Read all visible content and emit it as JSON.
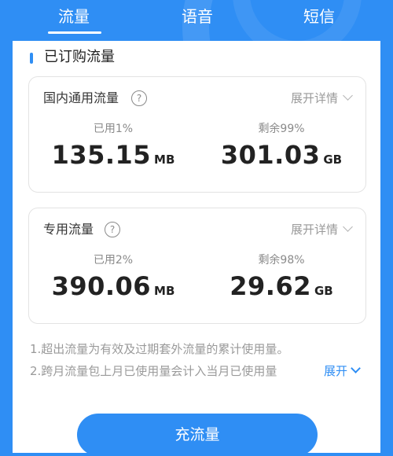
{
  "tabs": [
    {
      "label": "流量",
      "active": true
    },
    {
      "label": "语音",
      "active": false
    },
    {
      "label": "短信",
      "active": false
    }
  ],
  "section": {
    "title": "已订购流量"
  },
  "cards": [
    {
      "title": "国内通用流量",
      "help_icon": "question-circle-icon",
      "expand_label": "展开详情",
      "used": {
        "label": "已用1%",
        "value": "135.15",
        "unit": "MB"
      },
      "remaining": {
        "label": "剩余99%",
        "value": "301.03",
        "unit": "GB"
      }
    },
    {
      "title": "专用流量",
      "help_icon": "question-circle-icon",
      "expand_label": "展开详情",
      "used": {
        "label": "已用2%",
        "value": "390.06",
        "unit": "MB"
      },
      "remaining": {
        "label": "剩余98%",
        "value": "29.62",
        "unit": "GB"
      }
    }
  ],
  "notes": [
    "1.超出流量为有效及过期套外流量的累计使用量。",
    "2.跨月流量包上月已使用量会计入当月已使用量"
  ],
  "notes_expand_label": "展开",
  "cta_label": "充流量",
  "colors": {
    "accent": "#2f8ef4",
    "text": "#222222",
    "muted": "#9a9a9a"
  }
}
